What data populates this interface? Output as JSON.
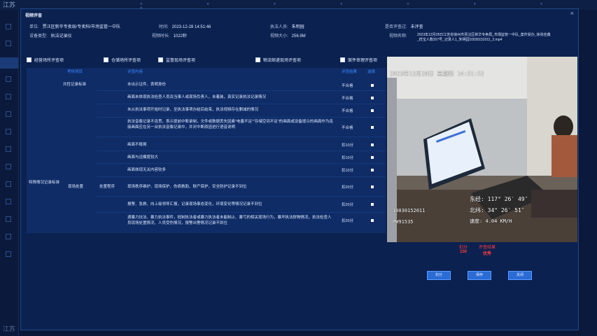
{
  "app": {
    "logo_text": "江苏"
  },
  "modal": {
    "title": "视频评查",
    "close_glyph": "×"
  },
  "info": {
    "unit_label": "单位:",
    "unit_value": "贾汪区新华专卖局/专卖科/市场监管一中队",
    "time_label": "时间:",
    "time_value": "2023-12-28 14:51:46",
    "enforcer_label": "执法人员:",
    "enforcer_value": "朱明园",
    "reviewed_label": "是否评查过:",
    "reviewed_value": "未评查",
    "device_label": "设备类型:",
    "device_value": "执法记录仪",
    "duration_label": "视频时长:",
    "duration_value": "1022秒",
    "size_label": "视频大小:",
    "size_value": "256.9M",
    "filename_label": "视频名称:",
    "filename_value_line1": "2023年12月28日江苏省徐州市贾汪区新华专卖局_市场监管一中队_案件受办_徐张佳鑫",
    "filename_value_line2": "_样宝人数207号_记录人1_朱明园10030152011_2.mp4"
  },
  "checks": [
    {
      "label": "经营场所评查项"
    },
    {
      "label": "仓储场所评查项"
    },
    {
      "label": "监督现场评查项"
    },
    {
      "label": "物流邮递现场评查项"
    },
    {
      "label": "案件审理评查项"
    }
  ],
  "table": {
    "headers": {
      "item": "考核项目",
      "content": "评查内容",
      "result": "评查结果",
      "mark": "选择"
    },
    "group1": "共性记录标准",
    "group2": "特殊情况记录标准",
    "sub1": "现场处置",
    "sub2": "处置程序",
    "rows": [
      {
        "text": "未出示证件、表明身份",
        "result": "不合格"
      },
      {
        "text": "画面未体现执法检查人员及当事人或现场负责人，未着装，真实记录执法记录情况",
        "result": "不合格"
      },
      {
        "text": "未从执法事项开始时记录，至执法事项办结后结束，执法视频存在删减的情况",
        "result": "不合格"
      },
      {
        "text": "执法音像记录不连贯，表示提前中断录制，文件或数据丢失因素\"电量不足\"\"存储空间不足\"的画面或设备提示的画面作为连接画面应在另一台执法音像记录中，并对中断原因进行语音说明",
        "result": "不合格"
      },
      {
        "text": "画面不稳晃",
        "result": "扣10分"
      },
      {
        "text": "画面与远模度较大",
        "result": "扣10分"
      },
      {
        "text": "画面体现无关内容较多",
        "result": "扣10分"
      },
      {
        "text": "现场秩序维护、现场保护、伤病救助、财产保护、安全防护记录不到位",
        "result": "扣20分"
      },
      {
        "text": "报警、急救、向上级领导汇报，记录现场事态变化，环境变化等情况记录不到位",
        "result": "扣20分"
      },
      {
        "text": "遇暴力抗法、暴力执法事件，抵制执法者或暴力执法者未能制止、暴亏的相关现场行为，暴坏执法财物情况，执法检查人员现场处置情况、人员受伤情况，报警出警情况记录不到位",
        "result": "扣20分"
      }
    ]
  },
  "video": {
    "timestamp_date": "2023年12月28日",
    "timestamp_weekday": "星期四",
    "timestamp_time": "14:51:52",
    "lng": "东经: 117° 26′ 49″",
    "lat": "北纬: 34° 26′ 51″",
    "speed": "速度: 4.04 KM/H",
    "device_id": "10030152011",
    "device_code": "PW91535"
  },
  "score": {
    "deduct_label": "扣分",
    "deduct_value": "150",
    "result_label": "评查结果",
    "result_value": "优秀"
  },
  "buttons": {
    "deduct": "扣分",
    "save": "保存",
    "close": "关闭"
  }
}
